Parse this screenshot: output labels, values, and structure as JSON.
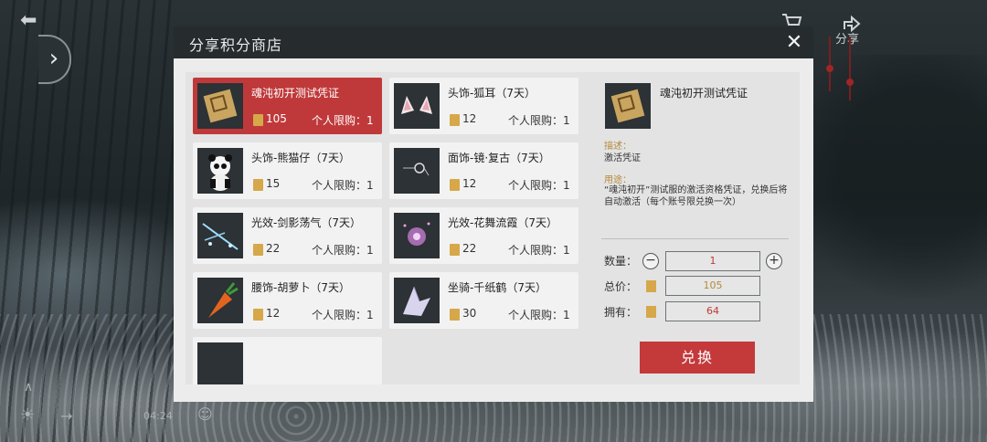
{
  "hud": {
    "share_label": "分享",
    "time": "04:24"
  },
  "dialog": {
    "title": "分享积分商店",
    "close_label": "✕"
  },
  "items": [
    {
      "name": "魂沌初开测试凭证",
      "price": "105",
      "limit": "个人限购：1",
      "selected": true,
      "icon": "voucher-icon"
    },
    {
      "name": "头饰-狐耳（7天）",
      "price": "12",
      "limit": "个人限购：1",
      "icon": "fox-ears-icon"
    },
    {
      "name": "头饰-熊猫仔（7天）",
      "price": "15",
      "limit": "个人限购：1",
      "icon": "panda-icon"
    },
    {
      "name": "面饰-镜·复古（7天）",
      "price": "12",
      "limit": "个人限购：1",
      "icon": "glasses-icon"
    },
    {
      "name": "光效-剑影荡气（7天）",
      "price": "22",
      "limit": "个人限购：1",
      "icon": "sword-shadow-icon"
    },
    {
      "name": "光效-花舞流霞（7天）",
      "price": "22",
      "limit": "个人限购：1",
      "icon": "flower-dance-icon"
    },
    {
      "name": "腰饰-胡萝卜（7天）",
      "price": "12",
      "limit": "个人限购：1",
      "icon": "carrot-icon"
    },
    {
      "name": "坐骑-千纸鹤（7天）",
      "price": "30",
      "limit": "个人限购：1",
      "icon": "paper-crane-icon"
    },
    {
      "name": "",
      "price": "",
      "limit": "",
      "icon": "partial-item-icon"
    }
  ],
  "detail": {
    "name": "魂沌初开测试凭证",
    "desc_label": "描述：",
    "desc": "激活凭证",
    "use_label": "用途：",
    "use": "“魂沌初开”测试服的激活资格凭证，兑换后将自动激活（每个账号限兑换一次）",
    "quantity_label": "数量：",
    "quantity": "1",
    "total_label": "总价：",
    "total": "105",
    "owned_label": "拥有：",
    "owned": "64",
    "minus_label": "−",
    "plus_label": "+",
    "exchange_label": "兑换"
  },
  "colors": {
    "accent": "#c0393a",
    "coin": "#d6a84a",
    "owned_text": "#c0393a"
  }
}
